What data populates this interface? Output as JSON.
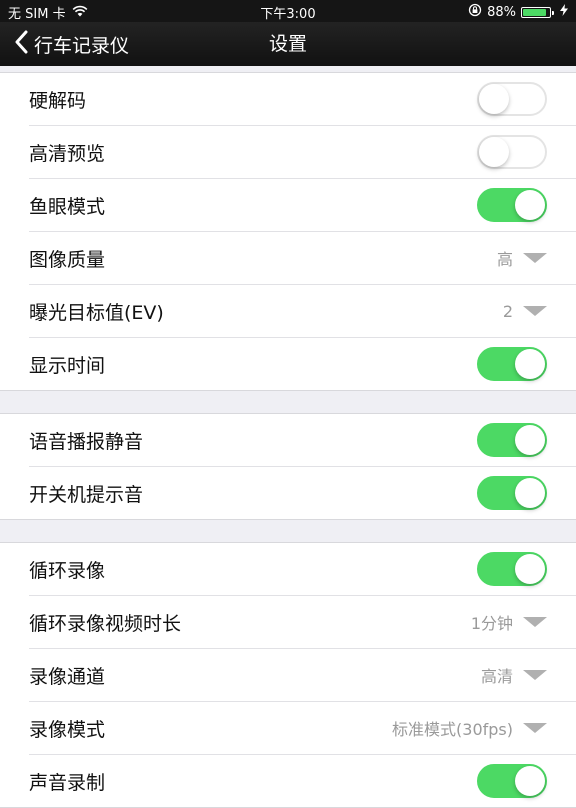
{
  "status_bar": {
    "carrier": "无 SIM 卡",
    "time": "下午3:00",
    "battery_percent_text": "88%",
    "battery_level": 0.88,
    "icons": [
      "wifi-icon",
      "rotation-lock-icon",
      "battery-icon",
      "charging-icon"
    ]
  },
  "nav": {
    "back_label": "行车记录仪",
    "title": "设置"
  },
  "colors": {
    "toggle_on": "#4cd964",
    "navbar_bg": "#1a1a1a",
    "value_text": "#9a9a9a"
  },
  "sections": [
    {
      "rows": [
        {
          "label": "硬解码",
          "type": "toggle",
          "on": false
        },
        {
          "label": "高清预览",
          "type": "toggle",
          "on": false
        },
        {
          "label": "鱼眼模式",
          "type": "toggle",
          "on": true
        },
        {
          "label": "图像质量",
          "type": "select",
          "value": "高"
        },
        {
          "label": "曝光目标值(EV)",
          "type": "select",
          "value": "2"
        },
        {
          "label": "显示时间",
          "type": "toggle",
          "on": true
        }
      ]
    },
    {
      "rows": [
        {
          "label": "语音播报静音",
          "type": "toggle",
          "on": true
        },
        {
          "label": "开关机提示音",
          "type": "toggle",
          "on": true
        }
      ]
    },
    {
      "rows": [
        {
          "label": "循环录像",
          "type": "toggle",
          "on": true
        },
        {
          "label": "循环录像视频时长",
          "type": "select",
          "value": "1分钟"
        },
        {
          "label": "录像通道",
          "type": "select",
          "value": "高清"
        },
        {
          "label": "录像模式",
          "type": "select",
          "value": "标准模式(30fps)"
        },
        {
          "label": "声音录制",
          "type": "toggle",
          "on": true
        }
      ]
    }
  ]
}
